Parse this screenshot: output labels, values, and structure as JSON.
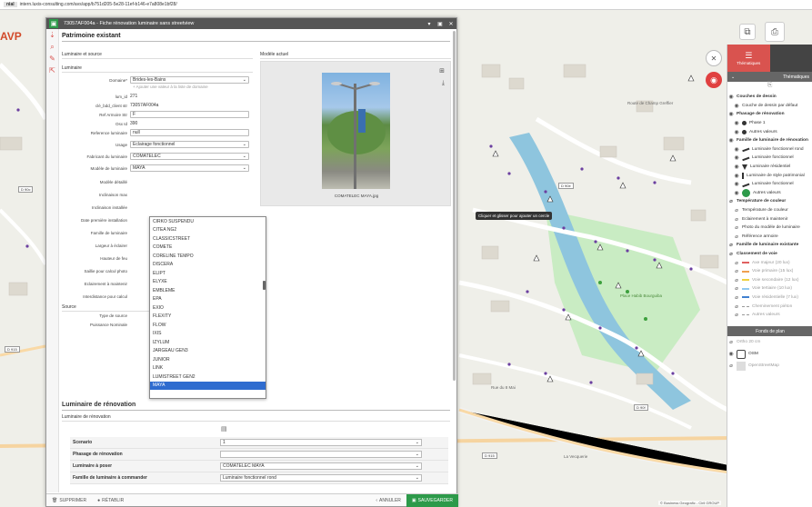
{
  "browser": {
    "tag": "nial",
    "url": "intern.luxis-consulting.com/avs/app/b751d205-5e28-11ef-b146-e7a808e1bf28/"
  },
  "app": {
    "brand": "AVP"
  },
  "map": {
    "tooltip": "Cliquer et glisser pour ajouter un cercle",
    "attribution": "© Business Geografic - Ciril GROUP",
    "labels": [
      "Place Habib Bourguiba",
      "Rue du 8 Mai",
      "Route de Champ Greffier",
      "La Vecquerie",
      "Cafe ferse",
      "Rue des Thermes"
    ],
    "roads": [
      "D 90c",
      "D 915",
      "D 90e",
      "D 90f"
    ]
  },
  "modal": {
    "title": "73057AF004a - Fiche rénovation luminaire sans streetview",
    "section_title": "Patrimoine existant",
    "col1_header": "Luminaire et source",
    "col2_header": "Modèle actuel",
    "luminaire_header": "Luminaire",
    "domaine_label": "Domaine",
    "domaine_value": "Brides-les-Bains",
    "domaine_hint": "+ Ajouter une valeur à la liste de domaine",
    "fields": [
      {
        "label": "lum_id",
        "value": "271"
      },
      {
        "label": "clé_bdd_client str",
        "value": "73057AF004a"
      },
      {
        "label": "Ref Armoire Str",
        "value": "F"
      },
      {
        "label": "Osx Id",
        "value": "390"
      },
      {
        "label": "Reference luminaire",
        "value": "null"
      },
      {
        "label": "Usage",
        "value": "Eclairage fonctionnel"
      },
      {
        "label": "Fabricant du luminaire",
        "value": "COMATELEC"
      },
      {
        "label": "Modèle de luminaire",
        "value": "MAYA"
      }
    ],
    "hidden_labels": [
      "Modèle détaillé",
      "Inclinaison max",
      "Inclinaison installée",
      "Date première installation",
      "Famille de luminaire",
      "Largeur à éclairer",
      "Hauteur de feu",
      "Saillie pour calcul photo",
      "Eclairement à maintenir",
      "Interdistance pour calcul"
    ],
    "source_header": "Source",
    "source_fields": [
      "Type de source",
      "Puissance Nominale"
    ],
    "dropdown_options": [
      "CIRKO SUSPENDU",
      "CITEA NG2",
      "CLASSICSTREET",
      "COMETE",
      "CORELINE TEMPO",
      "DISCERA",
      "ELIPT",
      "ELYXE",
      "EMBLEME",
      "EPA",
      "EXIO",
      "FLEXITY",
      "FLOW",
      "IXIS",
      "IZYLUM",
      "JARGEAU GEN3",
      "JUNIOR",
      "LINK",
      "LUMISTREET GEN2",
      "MAYA"
    ],
    "dropdown_selected": "MAYA",
    "photo_caption": "COMATELEC MAYA.jpg",
    "renov_title": "Luminaire de rénovation",
    "renov_sub": "Luminaire de rénovation",
    "renov_rows": [
      {
        "label": "Scenario",
        "value": "1"
      },
      {
        "label": "Phasage de rénovation",
        "value": ""
      },
      {
        "label": "Luminaire à poser",
        "value": "COMATELEC MAYA"
      },
      {
        "label": "Famille de luminaire à commander",
        "value": "Luminaire fonctionnel rond"
      }
    ],
    "footer": {
      "delete": "SUPPRIMER",
      "restore": "RÉTABLIR",
      "cancel": "ANNULER",
      "save": "SAUVEGARDER"
    }
  },
  "panel": {
    "tab1": "Thématiques",
    "section": "Thématiques",
    "items": [
      {
        "text": "Couches de dessin",
        "style": "b",
        "sym": "eye"
      },
      {
        "text": "Couche de dessin par défaut",
        "style": "",
        "sym": "eye"
      },
      {
        "text": "Phasage de rénovation",
        "style": "b",
        "sym": "eye"
      },
      {
        "text": "Phase 1",
        "style": "",
        "sym": "dot"
      },
      {
        "text": "Autres valeurs",
        "style": "",
        "sym": "dot"
      },
      {
        "text": "Famille de luminaire de rénovation",
        "style": "b",
        "sym": "eye"
      },
      {
        "text": "Luminaire fonctionnel rond",
        "style": "",
        "sym": "lamp"
      },
      {
        "text": "Luminaire fonctionnel",
        "style": "",
        "sym": "lamp"
      },
      {
        "text": "Luminaire résidentiel",
        "style": "",
        "sym": "tri"
      },
      {
        "text": "Luminaire de style patrimonial",
        "style": "",
        "sym": "post"
      },
      {
        "text": "Luminaire fonctionnel",
        "style": "",
        "sym": "lamp"
      },
      {
        "text": "Autres valeurs",
        "style": "",
        "sym": "green"
      },
      {
        "text": "Température de couleur",
        "style": "b",
        "sym": "off"
      },
      {
        "text": "Température de couleur",
        "style": "",
        "sym": "off"
      },
      {
        "text": "Eclairement à maintenir",
        "style": "",
        "sym": "off"
      },
      {
        "text": "Photo du modèle de luminaire",
        "style": "",
        "sym": "off"
      },
      {
        "text": "Référence armoire",
        "style": "",
        "sym": "off"
      },
      {
        "text": "Famille de luminaire existante",
        "style": "b",
        "sym": "off"
      },
      {
        "text": "Classement de voie",
        "style": "b",
        "sym": "off"
      },
      {
        "text": "Axe majeur (20 lux)",
        "style": "g",
        "sym": "red"
      },
      {
        "text": "Voie primaire (15 lux)",
        "style": "g",
        "sym": "orange"
      },
      {
        "text": "Voie secondaire (12 lux)",
        "style": "g",
        "sym": "yellow"
      },
      {
        "text": "Voie tertiaire (10 lux)",
        "style": "g",
        "sym": "lblue"
      },
      {
        "text": "Voie résidentielle (7 lux)",
        "style": "g",
        "sym": "blue"
      },
      {
        "text": "Cheminement piéton",
        "style": "g",
        "sym": "dash"
      },
      {
        "text": "Autres valeurs",
        "style": "g",
        "sym": "dash"
      }
    ],
    "bg_section": "Fonds de plan",
    "bg_items": [
      "Ortho 20 cm",
      "OSM",
      "OpenStreetMap"
    ]
  },
  "colors": {
    "accent": "#2d9a4a",
    "danger": "#d9534f",
    "select": "#2f6ccf"
  }
}
